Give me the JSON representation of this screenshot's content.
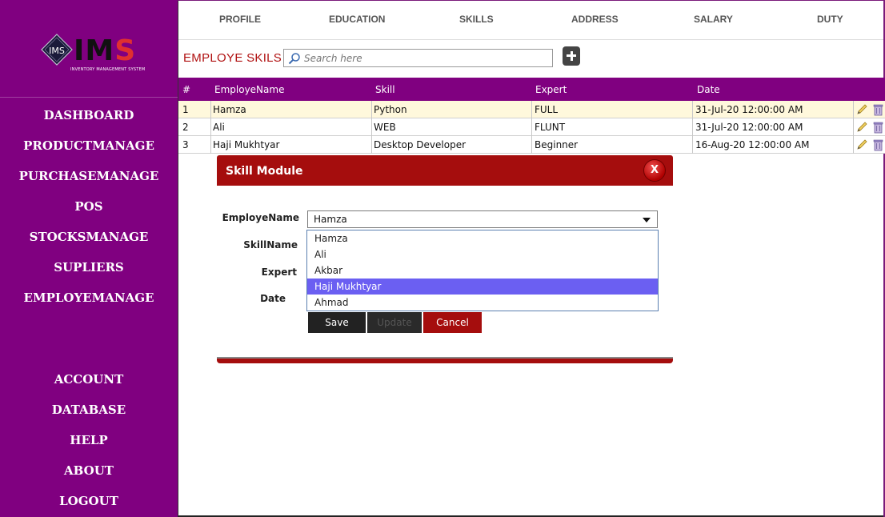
{
  "logo": {
    "mark": "IMS",
    "letters_dark": "IM",
    "letters_red": "S",
    "subtitle": "INVENTORY MANAGEMENT SYSTEM"
  },
  "sidebar": {
    "items": [
      {
        "label": "DASHBOARD"
      },
      {
        "label": "PRODUCTMANAGE"
      },
      {
        "label": "PURCHASEMANAGE"
      },
      {
        "label": "POS"
      },
      {
        "label": "STOCKSMANAGE"
      },
      {
        "label": "SUPLIERS"
      },
      {
        "label": "EMPLOYEMANAGE"
      }
    ],
    "bottom_items": [
      {
        "label": "ACCOUNT"
      },
      {
        "label": "DATABASE"
      },
      {
        "label": "HELP"
      },
      {
        "label": "ABOUT"
      },
      {
        "label": "LOGOUT"
      }
    ]
  },
  "tabs": [
    {
      "label": "PROFILE"
    },
    {
      "label": "EDUCATION"
    },
    {
      "label": "SKILLS"
    },
    {
      "label": "ADDRESS"
    },
    {
      "label": "SALARY"
    },
    {
      "label": "DUTY"
    }
  ],
  "header": {
    "title": "EMPLOYE SKILS",
    "search_placeholder": "Search here",
    "add_icon": "plus-square-icon"
  },
  "table": {
    "columns": [
      "#",
      "EmployeName",
      "Skill",
      "Expert",
      "Date"
    ],
    "rows": [
      {
        "id": "1",
        "name": "Hamza",
        "skill": "Python",
        "expert": "FULL",
        "date": "31-Jul-20 12:00:00 AM"
      },
      {
        "id": "2",
        "name": "Ali",
        "skill": "WEB",
        "expert": "FLUNT",
        "date": "31-Jul-20 12:00:00 AM"
      },
      {
        "id": "3",
        "name": "Haji Mukhtyar",
        "skill": "Desktop Developer",
        "expert": "Beginner",
        "date": "16-Aug-20 12:00:00 AM"
      }
    ]
  },
  "modal": {
    "title": "Skill Module",
    "close_label": "X",
    "labels": {
      "employe_name": "EmployeName",
      "skill_name": "SkillName",
      "expert": "Expert",
      "date": "Date"
    },
    "employe_select": {
      "value": "Hamza",
      "options": [
        "Hamza",
        "Ali",
        "Akbar",
        "Haji Mukhtyar",
        "Ahmad"
      ],
      "highlighted": "Haji Mukhtyar"
    },
    "buttons": {
      "save": "Save",
      "update": "Update",
      "cancel": "Cancel"
    }
  },
  "colors": {
    "sidebar": "#800080",
    "accent_red": "#a50d0d",
    "selected_row": "#fff8dc",
    "highlight_option": "#6b5ff2"
  }
}
